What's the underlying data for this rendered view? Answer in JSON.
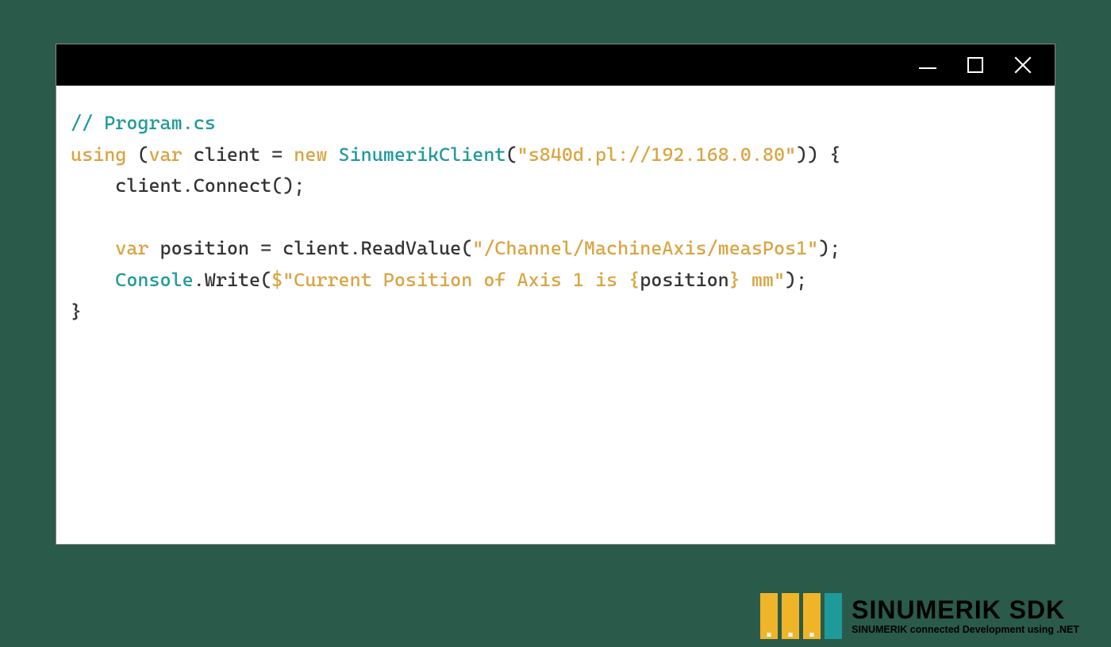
{
  "code": {
    "lines": [
      {
        "indent": 0,
        "tokens": [
          {
            "cls": "tok-comment",
            "t": "// Program.cs"
          }
        ]
      },
      {
        "indent": 0,
        "tokens": [
          {
            "cls": "tok-keyword",
            "t": "using"
          },
          {
            "cls": "tok-default",
            "t": " ("
          },
          {
            "cls": "tok-keyword",
            "t": "var"
          },
          {
            "cls": "tok-default",
            "t": " client = "
          },
          {
            "cls": "tok-keyword",
            "t": "new"
          },
          {
            "cls": "tok-default",
            "t": " "
          },
          {
            "cls": "tok-type",
            "t": "SinumerikClient"
          },
          {
            "cls": "tok-default",
            "t": "("
          },
          {
            "cls": "tok-string",
            "t": "\"s840d.pl://192.168.0.80\""
          },
          {
            "cls": "tok-default",
            "t": ")) {"
          }
        ]
      },
      {
        "indent": 1,
        "tokens": [
          {
            "cls": "tok-default",
            "t": "client.Connect();"
          }
        ]
      },
      {
        "indent": 0,
        "tokens": []
      },
      {
        "indent": 1,
        "tokens": [
          {
            "cls": "tok-keyword",
            "t": "var"
          },
          {
            "cls": "tok-default",
            "t": " position = client.ReadValue("
          },
          {
            "cls": "tok-string",
            "t": "\"/Channel/MachineAxis/measPos1\""
          },
          {
            "cls": "tok-default",
            "t": ");"
          }
        ]
      },
      {
        "indent": 1,
        "tokens": [
          {
            "cls": "tok-type",
            "t": "Console"
          },
          {
            "cls": "tok-default",
            "t": ".Write("
          },
          {
            "cls": "tok-string",
            "t": "$\"Current Position of Axis 1 is "
          },
          {
            "cls": "tok-interp",
            "t": "{"
          },
          {
            "cls": "tok-default",
            "t": "position"
          },
          {
            "cls": "tok-interp",
            "t": "}"
          },
          {
            "cls": "tok-string",
            "t": " mm\""
          },
          {
            "cls": "tok-default",
            "t": ");"
          }
        ]
      },
      {
        "indent": 0,
        "tokens": [
          {
            "cls": "tok-default",
            "t": "}"
          }
        ]
      }
    ]
  },
  "logo": {
    "title_strong": "SINUMERIK",
    "title_light": " SDK",
    "subtitle": "SINUMERIK connected Development using .NET"
  }
}
